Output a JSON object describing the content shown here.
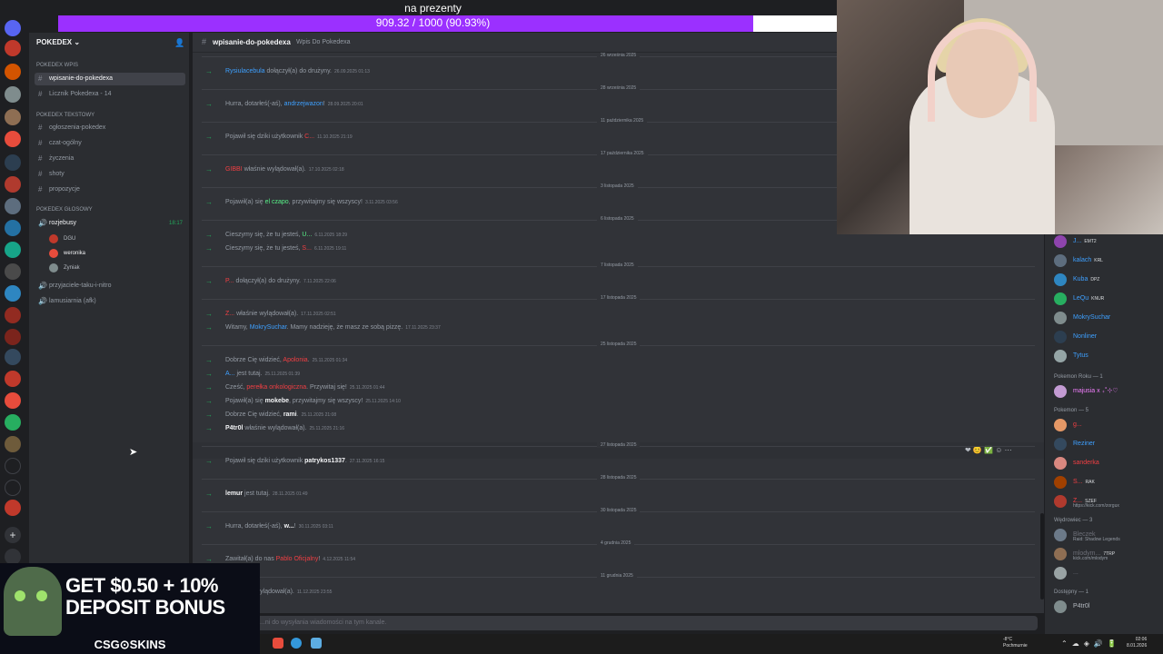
{
  "goal": {
    "title": "na prezenty",
    "progress_text": "909.32 / 1000 (90.93%)",
    "progress_fraction": 0.9093
  },
  "sidebar": {
    "server_name": "POKEDEX",
    "categories": [
      "POKEDEX Wpis",
      "POKEDEX Tekstowy",
      "POKEDEX GŁOSOWY"
    ],
    "channels": [
      "wpisanie-do-pokedexa",
      "Licznik Pokedexa - 14",
      "ogłoszenia-pokedex",
      "czat-ogólny",
      "życzenia",
      "shoty",
      "propozycje",
      "rozjebusy",
      "przyjaciele-taku-i-nitro",
      "lamusiarnia (afk)"
    ],
    "voice_time": "18:17",
    "voice_users": [
      "DGU",
      "weronika",
      "Zyniak"
    ]
  },
  "header": {
    "channel": "wpisanie-do-pokedexa",
    "topic": "Wpis Do Pokedexa"
  },
  "dates": [
    "26 września 2025",
    "28 września 2025",
    "11 października 2025",
    "17 października 2025",
    "3 listopada 2025",
    "6 listopada 2025",
    "7 listopada 2025",
    "17 listopada 2025",
    "25 listopada 2025",
    "27 listopada 2025",
    "28 listopada 2025",
    "30 listopada 2025",
    "4 grudnia 2025",
    "11 grudnia 2025"
  ],
  "messages": [
    {
      "pre": "",
      "user": "Rysiulacebula",
      "post": " dołączył(a) do drużyny.",
      "ts": "26.09.2025 01:13"
    },
    {
      "pre": "Hurra, dotarłeś(-aś), ",
      "user": "andrzejwazon",
      "post": "!",
      "ts": "28.09.2025 20:01"
    },
    {
      "pre": "Pojawił się dziki użytkownik ",
      "user": "C...",
      "post": "",
      "ts": "11.10.2025 21:19"
    },
    {
      "pre": "",
      "user": "GIBBI",
      "post": " właśnie wylądował(a).",
      "ts": "17.10.2025 02:18"
    },
    {
      "pre": "Pojawił(a) się ",
      "user": "el czapo",
      "post": ", przywitajmy się wszyscy!",
      "ts": "3.11.2025 03:56"
    },
    {
      "pre": "Cieszymy się, że tu jesteś, ",
      "user": "U...",
      "post": "",
      "ts": "6.11.2025 18:29"
    },
    {
      "pre": "Cieszymy się, że tu jesteś, ",
      "user": "S...",
      "post": "",
      "ts": "6.11.2025 19:11"
    },
    {
      "pre": "",
      "user": "P...",
      "post": " dołączył(a) do drużyny.",
      "ts": "7.11.2025 22:06"
    },
    {
      "pre": "",
      "user": "Z...",
      "post": " właśnie wylądował(a).",
      "ts": "17.11.2025 02:51"
    },
    {
      "pre": "Witamy, ",
      "user": "MokrySuchar",
      "post": ". Mamy nadzieję, że masz ze sobą pizzę.",
      "ts": "17.11.2025 23:37"
    },
    {
      "pre": "Dobrze Cię widzieć, ",
      "user": "Apolonia",
      "post": ".",
      "ts": "25.11.2025 01:34"
    },
    {
      "pre": "",
      "user": "A...",
      "post": " jest tutaj.",
      "ts": "25.11.2025 01:39"
    },
    {
      "pre": "Cześć, ",
      "user": "perełka onkologiczna",
      "post": ". Przywitaj się!",
      "ts": "25.11.2025 01:44"
    },
    {
      "pre": "Pojawił(a) się ",
      "user": "mokebe",
      "post": ", przywitajmy się wszyscy!",
      "ts": "25.11.2025 14:10"
    },
    {
      "pre": "Dobrze Cię widzieć, ",
      "user": "rami",
      "post": ".",
      "ts": "25.11.2025 21:08"
    },
    {
      "pre": "",
      "user": "P4tr0l",
      "post": " właśnie wylądował(a).",
      "ts": "25.11.2025 21:16"
    },
    {
      "pre": "Pojawił się dziki użytkownik ",
      "user": "patrykos1337",
      "post": ".",
      "ts": "27.11.2025 16:15"
    },
    {
      "pre": "",
      "user": "lemur",
      "post": " jest tutaj.",
      "ts": "28.11.2025 01:49"
    },
    {
      "pre": "Hurra, dotarłeś(-aś), ",
      "user": "w...",
      "post": "!",
      "ts": "30.11.2025 03:11"
    },
    {
      "pre": "Zawitał(a) do nas ",
      "user": "Pablo Oficjalny",
      "post": "!",
      "ts": "4.12.2025 11:54"
    },
    {
      "pre": "",
      "user": "...",
      "post": " właśnie wylądował(a).",
      "ts": "11.12.2025 23:55"
    }
  ],
  "input_placeholder": "...ni do wysyłania wiadomości na tym kanale.",
  "members": {
    "top": [
      {
        "name": "J...",
        "tag": "EMT2"
      },
      {
        "name": "kalach",
        "tag": "KRL"
      },
      {
        "name": "Kuba",
        "tag": "DPZ"
      },
      {
        "name": "LeQu",
        "tag": "KNUR"
      },
      {
        "name": "MokrySuchar",
        "tag": ""
      },
      {
        "name": "Nonliner",
        "tag": ""
      },
      {
        "name": "Tytus",
        "tag": ""
      }
    ],
    "cat_roku": "Pokemon Roku — 1",
    "roku": [
      {
        "name": "majusia x ₊˚⊹♡",
        "tag": ""
      }
    ],
    "cat_pokemon": "Pokemon — 5",
    "pokemon": [
      {
        "name": "g...",
        "tag": ""
      },
      {
        "name": "Reziner",
        "tag": ""
      },
      {
        "name": "sanderka",
        "tag": ""
      },
      {
        "name": "S...",
        "tag": "RAK"
      },
      {
        "name": "Z...",
        "tag": "SZEF",
        "sub": "https://kick.com/zorgux"
      }
    ],
    "cat_wedrowiec": "Wędrowiec — 3",
    "wedrowiec": [
      {
        "name": "Bleczek",
        "tag": "",
        "sub": "Raid: Shadow Legends"
      },
      {
        "name": "mlodym...",
        "tag": "7TRP",
        "sub": "kick.com/mlodym"
      },
      {
        "name": "...",
        "tag": ""
      }
    ],
    "cat_dostepny": "Dostępny — 1",
    "dostepny": [
      {
        "name": "P4tr0l",
        "tag": ""
      }
    ]
  },
  "ad": {
    "line1": "GET $0.50 + 10%",
    "line2": "DEPOSIT BONUS",
    "brand": "CSG⊙SKINS"
  },
  "taskbar": {
    "weather_temp": "-8°C",
    "weather_desc": "Pochmurnie",
    "time": "02:06",
    "date": "8.01.2026"
  },
  "colors": {
    "accent": "#9b30ff",
    "online": "#23a55a",
    "link": "#3ea0ff",
    "danger": "#f23f43"
  }
}
